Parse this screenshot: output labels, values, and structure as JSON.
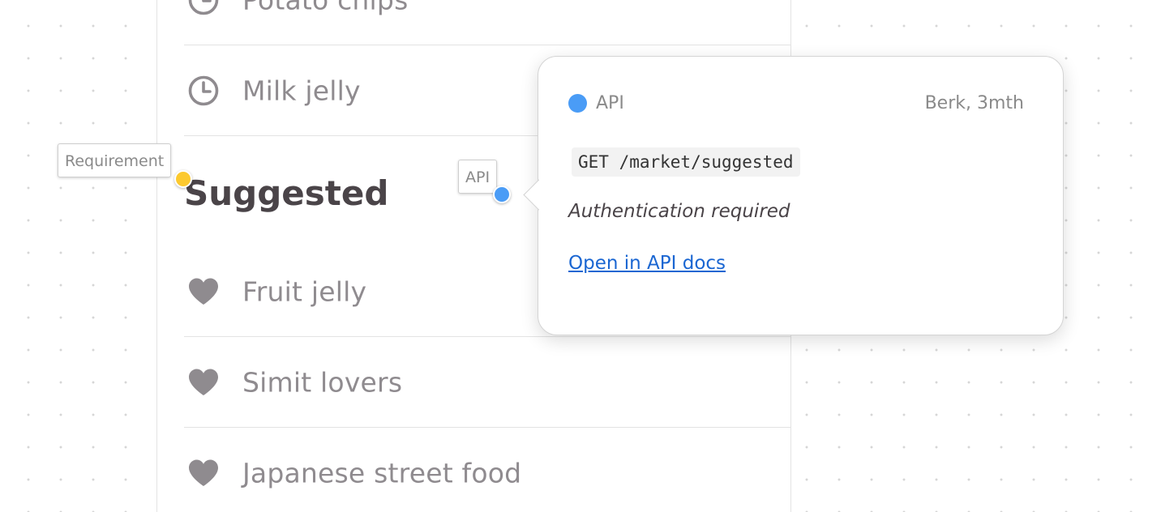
{
  "list": {
    "recent_items": [
      {
        "label": "Potato chips",
        "icon": "clock-icon"
      },
      {
        "label": "Milk jelly",
        "icon": "clock-icon"
      }
    ],
    "section_title": "Suggested",
    "suggested_items": [
      {
        "label": "Fruit jelly",
        "icon": "heart-icon"
      },
      {
        "label": "Simit lovers",
        "icon": "heart-icon"
      },
      {
        "label": "Japanese street food",
        "icon": "heart-icon"
      }
    ]
  },
  "annotations": {
    "requirement_tag": "Requirement",
    "requirement_color": "#fcc92e",
    "api_tag": "API",
    "api_color": "#4a9cf6"
  },
  "popover": {
    "type_label": "API",
    "author_meta": "Berk, 3mth",
    "endpoint": "GET /market/suggested",
    "description": "Authentication required",
    "link_label": "Open in API docs"
  },
  "colors": {
    "icon_gray": "#8f8b8f",
    "title_dark": "#4a4448",
    "link_blue": "#1a66d2"
  }
}
